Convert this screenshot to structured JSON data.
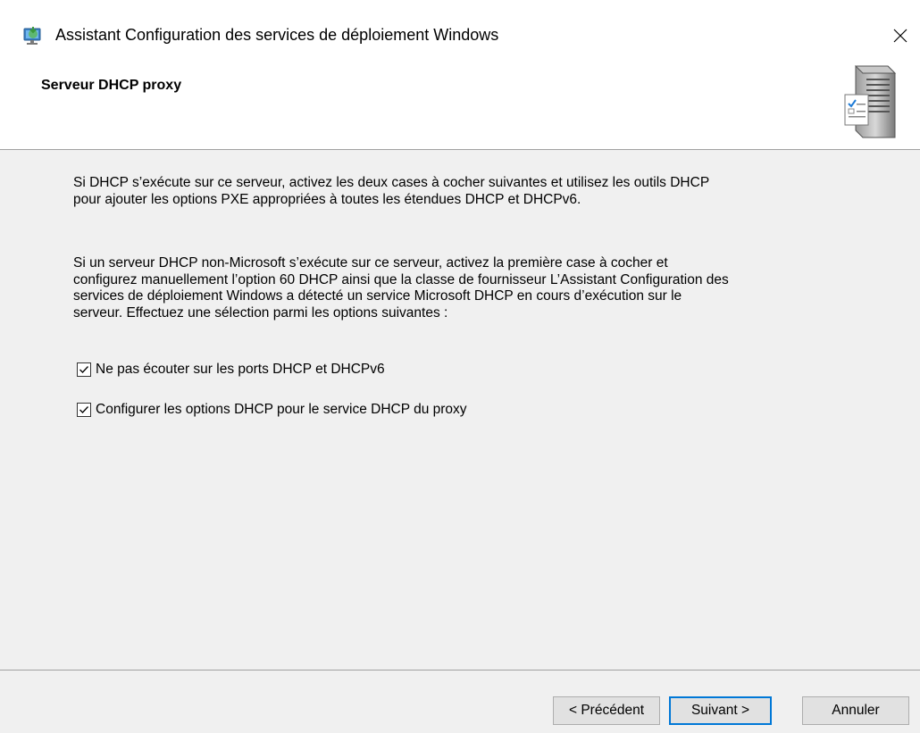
{
  "window": {
    "title": "Assistant Configuration des services de déploiement Windows",
    "close_glyph": "✕"
  },
  "header": {
    "title": "Serveur DHCP proxy",
    "icon": "server-checklist-icon"
  },
  "main": {
    "paragraph1": "Si DHCP s’exécute sur ce serveur, activez les deux cases à cocher suivantes et utilisez les outils DHCP pour ajouter les options PXE appropriées à toutes les étendues DHCP et DHCPv6.",
    "paragraph2": "Si un serveur DHCP non-Microsoft s’exécute sur ce serveur, activez la première case à cocher et configurez manuellement l’option 60 DHCP ainsi que la classe de fournisseur L’Assistant Configuration des services de déploiement Windows a détecté un service Microsoft DHCP en cours d’exécution sur le serveur. Effectuez une sélection parmi les options suivantes :",
    "checkboxes": [
      {
        "label": "Ne pas écouter sur les ports DHCP et DHCPv6",
        "checked": true
      },
      {
        "label": "Configurer les options DHCP pour le service DHCP du proxy",
        "checked": true
      }
    ]
  },
  "footer": {
    "previous_label": "< Précédent",
    "next_label": "Suivant >",
    "cancel_label": "Annuler"
  },
  "colors": {
    "default_button_border": "#0078d7",
    "background": "#f0f0f0",
    "header_background": "#ffffff"
  }
}
